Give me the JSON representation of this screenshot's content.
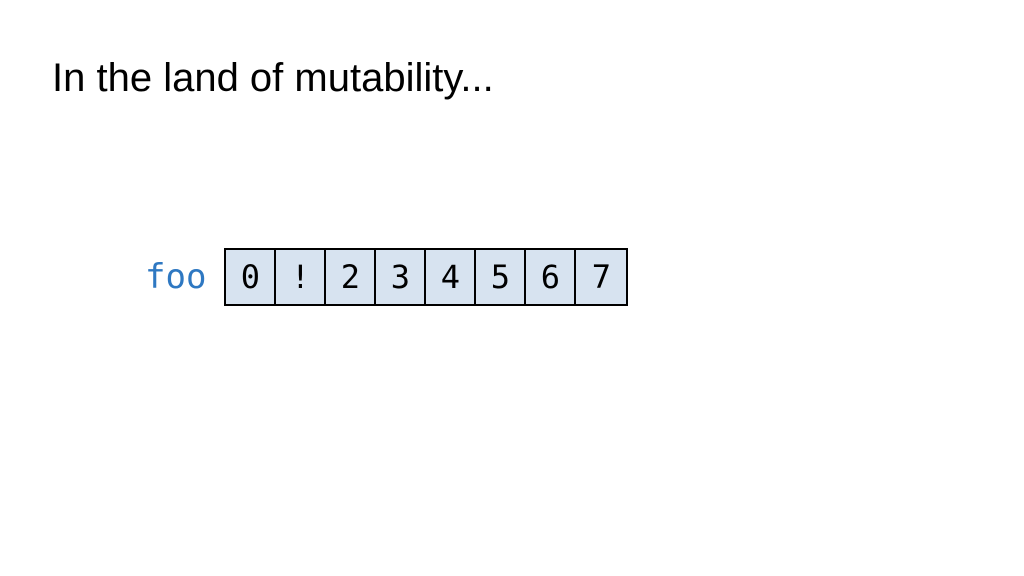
{
  "title": "In the land of mutability...",
  "varName": "foo",
  "cells": [
    "0",
    "!",
    "2",
    "3",
    "4",
    "5",
    "6",
    "7"
  ],
  "colors": {
    "cellBg": "#d7e3f0",
    "labelColor": "#2e78c2",
    "border": "#000000"
  }
}
